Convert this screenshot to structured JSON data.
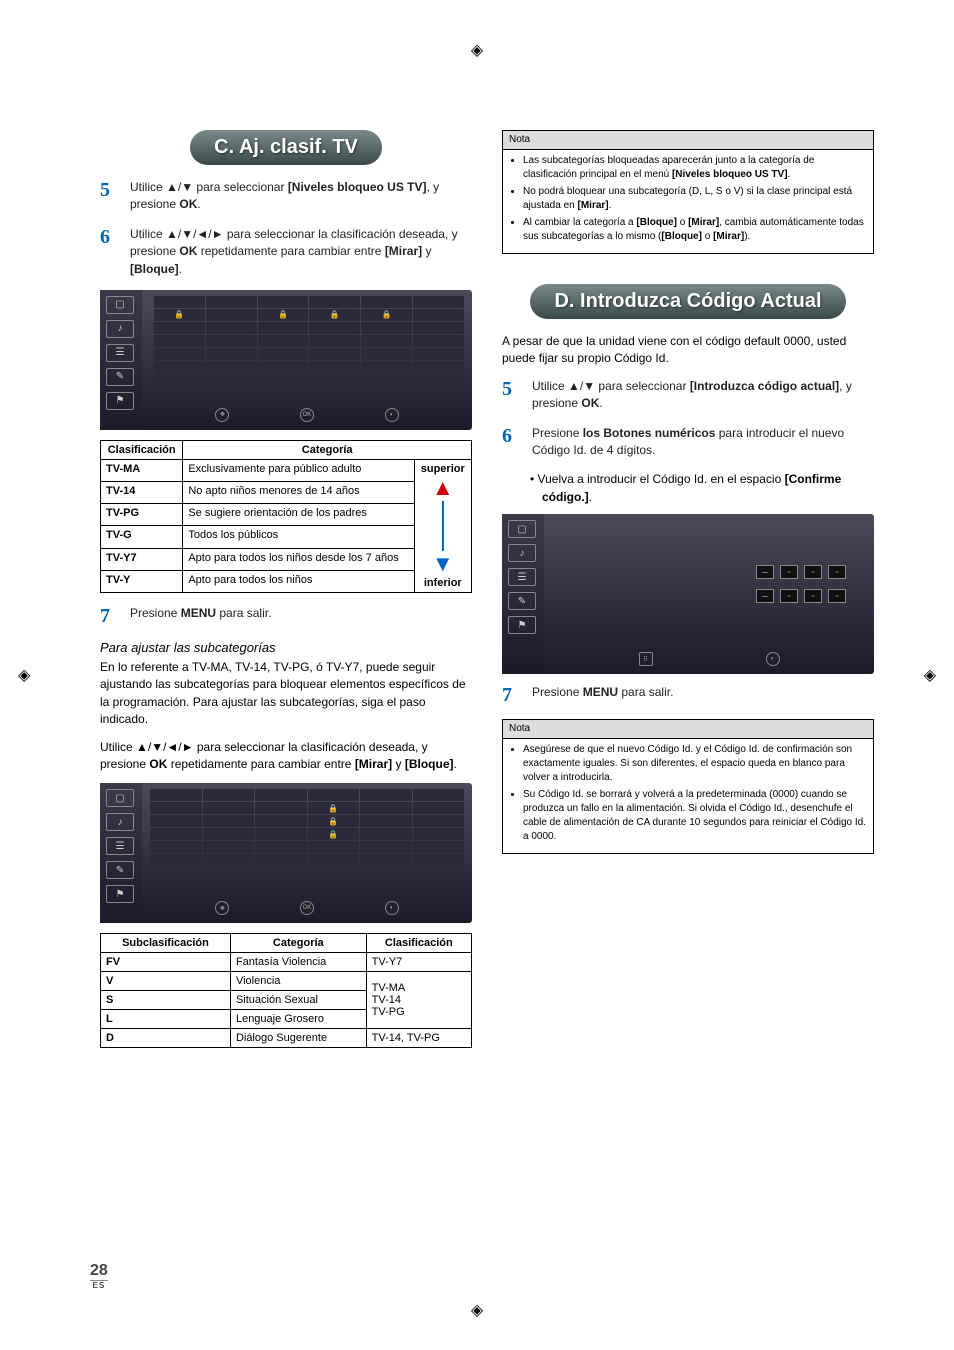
{
  "page": {
    "number": "28",
    "lang": "ES"
  },
  "section_c": {
    "title": "C. Aj. clasif. TV",
    "steps": {
      "5": "Utilice ▲/▼ para seleccionar [Niveles bloqueo US TV], y presione OK.",
      "6": "Utilice ▲/▼/◄/► para seleccionar la clasificación deseada, y presione OK repetidamente para cambiar entre [Mirar] y [Bloque].",
      "7": "Presione MENU para salir."
    },
    "table1_head": {
      "col1": "Clasificación",
      "col2": "Categoría"
    },
    "table1": [
      {
        "r": "TV-MA",
        "c": "Exclusivamente para público adulto"
      },
      {
        "r": "TV-14",
        "c": "No apto niños menores de 14 años"
      },
      {
        "r": "TV-PG",
        "c": "Se sugiere orientación de los padres"
      },
      {
        "r": "TV-G",
        "c": "Todos los públicos"
      },
      {
        "r": "TV-Y7",
        "c": "Apto para todos los niños desde los 7 años"
      },
      {
        "r": "TV-Y",
        "c": "Apto para todos los niños"
      }
    ],
    "table1_side": {
      "top": "superior",
      "bottom": "inferior"
    },
    "sub_title": "Para ajustar las subcategorías",
    "sub_para": "En lo referente a TV-MA, TV-14, TV-PG, ó TV-Y7, puede seguir ajustando las subcategorías para bloquear elementos específicos de la programación. Para ajustar las subcategorías, siga el paso indicado.",
    "sub_instr": "Utilice ▲/▼/◄/► para seleccionar la clasificación deseada, y presione OK repetidamente para cambiar entre [Mirar] y [Bloque].",
    "table2_head": {
      "col1": "Subclasificación",
      "col2": "Categoría",
      "col3": "Clasificación"
    },
    "table2": [
      {
        "r": "FV",
        "c": "Fantasía Violencia",
        "k": "TV-Y7"
      },
      {
        "r": "V",
        "c": "Violencia",
        "k": ""
      },
      {
        "r": "S",
        "c": "Situación Sexual",
        "k": ""
      },
      {
        "r": "L",
        "c": "Lenguaje Grosero",
        "k": ""
      },
      {
        "r": "D",
        "c": "Diálogo Sugerente",
        "k": "TV-14, TV-PG"
      }
    ],
    "table2_group": "TV-MA\nTV-14\nTV-PG"
  },
  "section_d": {
    "title": "D. Introduzca Código Actual",
    "intro": "A pesar de que la unidad viene con el código default 0000, usted puede fijar su propio Código Id.",
    "steps": {
      "5": "Utilice ▲/▼ para seleccionar [Introduzca código actual], y presione OK.",
      "6": "Presione los Botones numéricos para introducir el nuevo Código Id. de 4 dígitos.",
      "6_sub": "Vuelva a introducir el Código Id. en el espacio [Confirme código.].",
      "7": "Presione MENU para salir."
    }
  },
  "note1": {
    "title": "Nota",
    "items": [
      "Las subcategorías bloqueadas aparecerán junto a la categoría de clasificación principal en el menú [Niveles bloqueo US TV].",
      "No podrá bloquear una subcategoría (D, L, S o V) si la clase principal está ajustada en [Mirar].",
      "Al cambiar la categoría a [Bloque] o [Mirar], cambia automáticamente todas sus subcategorías a lo mismo ([Bloque] o [Mirar])."
    ]
  },
  "note2": {
    "title": "Nota",
    "items": [
      "Asegúrese de que el nuevo Código Id. y el Código Id. de confirmación son exactamente iguales. Si son diferentes, el espacio queda en blanco para volver a introducirla.",
      "Su Código Id. se borrará y volverá a la predeterminada (0000) cuando se produzca un fallo en la alimentación. Si olvida el Código Id., desenchufe el cable de alimentación de CA durante 10 segundos para reiniciar el Código Id. a 0000."
    ]
  },
  "osd_icons": {
    "ok": "OK",
    "back": "BACK",
    "arrows": "✥"
  }
}
